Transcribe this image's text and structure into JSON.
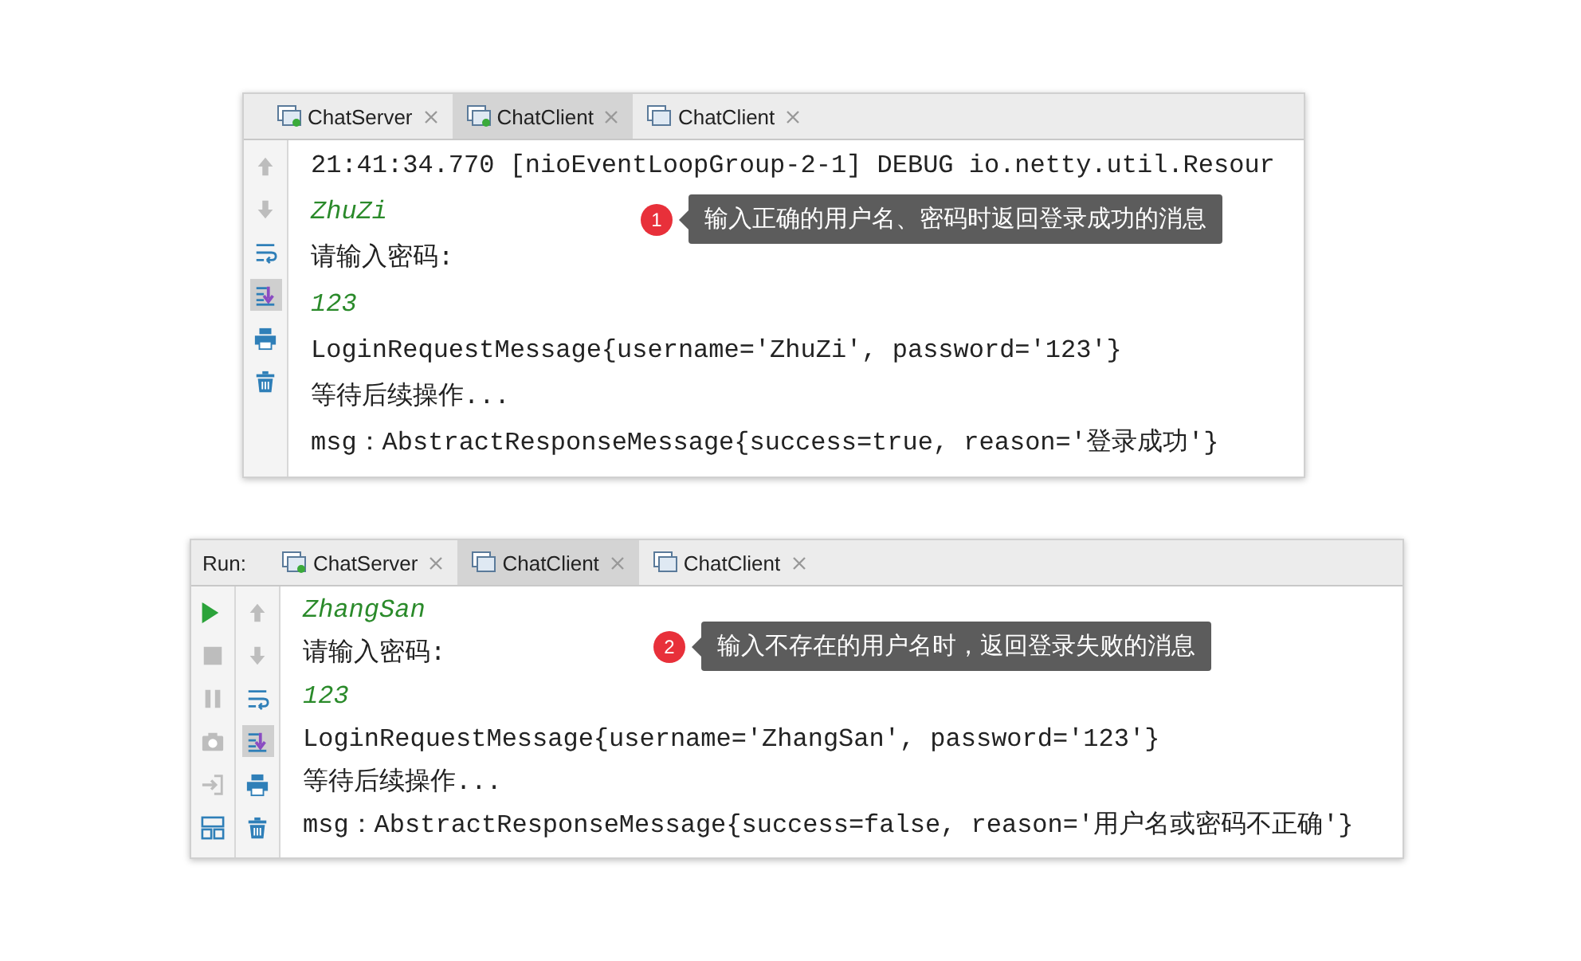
{
  "panels": [
    {
      "tabs": [
        {
          "label": "ChatServer",
          "running": true,
          "selected": false
        },
        {
          "label": "ChatClient",
          "running": true,
          "selected": true
        },
        {
          "label": "ChatClient",
          "running": false,
          "selected": false
        }
      ],
      "toolbar": [
        {
          "kind": "up",
          "disabled": true,
          "selected": false
        },
        {
          "kind": "down",
          "disabled": true,
          "selected": false
        },
        {
          "kind": "wrap",
          "disabled": false,
          "selected": false
        },
        {
          "kind": "scroll",
          "disabled": false,
          "selected": true
        },
        {
          "kind": "print",
          "disabled": false,
          "selected": false
        },
        {
          "kind": "trash",
          "disabled": false,
          "selected": false
        }
      ],
      "lines": [
        {
          "kind": "output",
          "text": "21:41:34.770 [nioEventLoopGroup-2-1] DEBUG io.netty.util.Resour"
        },
        {
          "kind": "input",
          "text": "ZhuZi"
        },
        {
          "kind": "output",
          "text": "请输入密码:"
        },
        {
          "kind": "input",
          "text": "123"
        },
        {
          "kind": "output",
          "text": "LoginRequestMessage{username='ZhuZi', password='123'}"
        },
        {
          "kind": "output",
          "text": "等待后续操作..."
        },
        {
          "kind": "output",
          "text": "msg：AbstractResponseMessage{success=true, reason='登录成功'}"
        }
      ],
      "callout": {
        "number": "1",
        "text": "输入正确的用户名、密码时返回登录成功的消息"
      }
    },
    {
      "run_label": "Run:",
      "tabs": [
        {
          "label": "ChatServer",
          "running": true,
          "selected": false
        },
        {
          "label": "ChatClient",
          "running": false,
          "selected": true
        },
        {
          "label": "ChatClient",
          "running": false,
          "selected": false
        }
      ],
      "run_toolbar": [
        {
          "kind": "run",
          "disabled": false,
          "selected": false
        },
        {
          "kind": "stop",
          "disabled": true,
          "selected": false
        },
        {
          "kind": "pause",
          "disabled": true,
          "selected": false
        },
        {
          "kind": "camera",
          "disabled": true,
          "selected": false
        },
        {
          "kind": "login",
          "disabled": true,
          "selected": false
        },
        {
          "kind": "layout",
          "disabled": false,
          "selected": false
        }
      ],
      "toolbar": [
        {
          "kind": "up",
          "disabled": true,
          "selected": false
        },
        {
          "kind": "down",
          "disabled": true,
          "selected": false
        },
        {
          "kind": "wrap",
          "disabled": false,
          "selected": false
        },
        {
          "kind": "scroll",
          "disabled": false,
          "selected": true
        },
        {
          "kind": "print",
          "disabled": false,
          "selected": false
        },
        {
          "kind": "trash",
          "disabled": false,
          "selected": false
        }
      ],
      "lines": [
        {
          "kind": "input",
          "text": "ZhangSan"
        },
        {
          "kind": "output",
          "text": "请输入密码:"
        },
        {
          "kind": "input",
          "text": "123"
        },
        {
          "kind": "output",
          "text": "LoginRequestMessage{username='ZhangSan', password='123'}"
        },
        {
          "kind": "output",
          "text": "等待后续操作..."
        },
        {
          "kind": "output",
          "text": "msg：AbstractResponseMessage{success=false, reason='用户名或密码不正确'}"
        }
      ],
      "callout": {
        "number": "2",
        "text": "输入不存在的用户名时，返回登录失败的消息"
      }
    }
  ]
}
